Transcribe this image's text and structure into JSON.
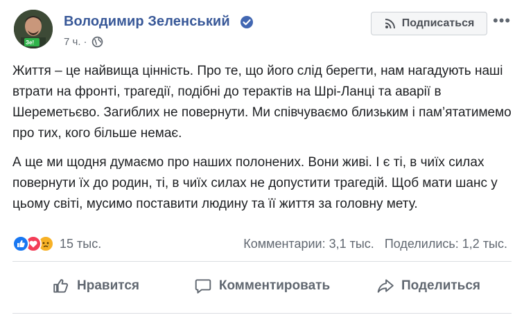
{
  "post": {
    "author": "Володимир Зеленський",
    "time": "7 ч.",
    "time_separator": "·",
    "avatar_badge": "Зе!",
    "subscribe_label": "Подписаться",
    "more_label": "•••",
    "paragraphs": [
      "Життя – це найвища цінність. Про те, що його слід берегти, нам нагадують наші втрати на фронті, трагедії, подібні до терактів на Шрі-Ланці та аварії в Шереметьєво. Загиблих не повернути. Ми співчуваємо близьким і пам’ятатимемо про тих, кого більше немає.",
      "А ще ми щодня думаємо про наших полонених. Вони живі. І є ті, в чиїх силах повернути їх до родин, ті, в чиїх силах не допустити трагедій. Щоб мати шанс у цьому світі, мусимо поставити людину та її життя за головну мету."
    ],
    "reactions": {
      "icons": [
        "like-icon",
        "love-icon",
        "sad-icon"
      ],
      "count": "15 тыс."
    },
    "stats": {
      "comments": "Комментарии: 3,1 тыс.",
      "shares": "Поделились: 1,2 тыс."
    },
    "actions": {
      "like": "Нравится",
      "comment": "Комментировать",
      "share": "Поделиться"
    },
    "colors": {
      "author": "#385898",
      "verified": "#4267b2",
      "muted": "#606770",
      "like": "#1877f2",
      "love": "#f33e58",
      "sad": "#f7b125"
    }
  }
}
